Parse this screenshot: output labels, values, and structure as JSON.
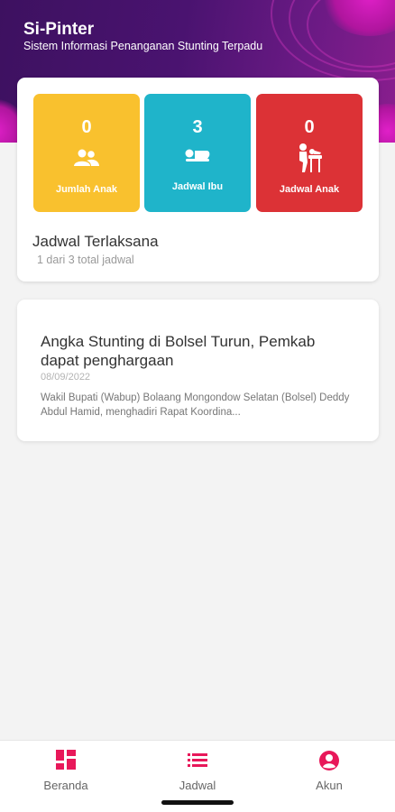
{
  "header": {
    "title": "Si-Pinter",
    "subtitle": "Sistem Informasi Penanganan Stunting Terpadu"
  },
  "stats": [
    {
      "count": "0",
      "label": "Jumlah Anak",
      "icon": "people-icon",
      "color": "#f9c12e"
    },
    {
      "count": "3",
      "label": "Jadwal Ibu",
      "icon": "mother-icon",
      "color": "#1fb4ca"
    },
    {
      "count": "0",
      "label": "Jadwal Anak",
      "icon": "baby-changing-icon",
      "color": "#dc3236"
    }
  ],
  "schedule": {
    "title": "Jadwal Terlaksana",
    "summary": "1 dari 3 total jadwal"
  },
  "news": {
    "title": "Angka Stunting di Bolsel Turun, Pemkab dapat penghargaan",
    "date": "08/09/2022",
    "excerpt": "Wakil Bupati (Wabup) Bolaang Mongondow Selatan (Bolsel) Deddy Abdul Hamid, menghadiri Rapat Koordina..."
  },
  "bottom_nav": {
    "items": [
      {
        "label": "Beranda",
        "icon": "dashboard-icon",
        "active": true
      },
      {
        "label": "Jadwal",
        "icon": "list-icon",
        "active": false
      },
      {
        "label": "Akun",
        "icon": "account-icon",
        "active": false
      }
    ]
  },
  "colors": {
    "header_bg": "#4a1370",
    "accent": "#e8185a",
    "yellow": "#f9c12e",
    "cyan": "#1fb4ca",
    "red": "#dc3236"
  }
}
